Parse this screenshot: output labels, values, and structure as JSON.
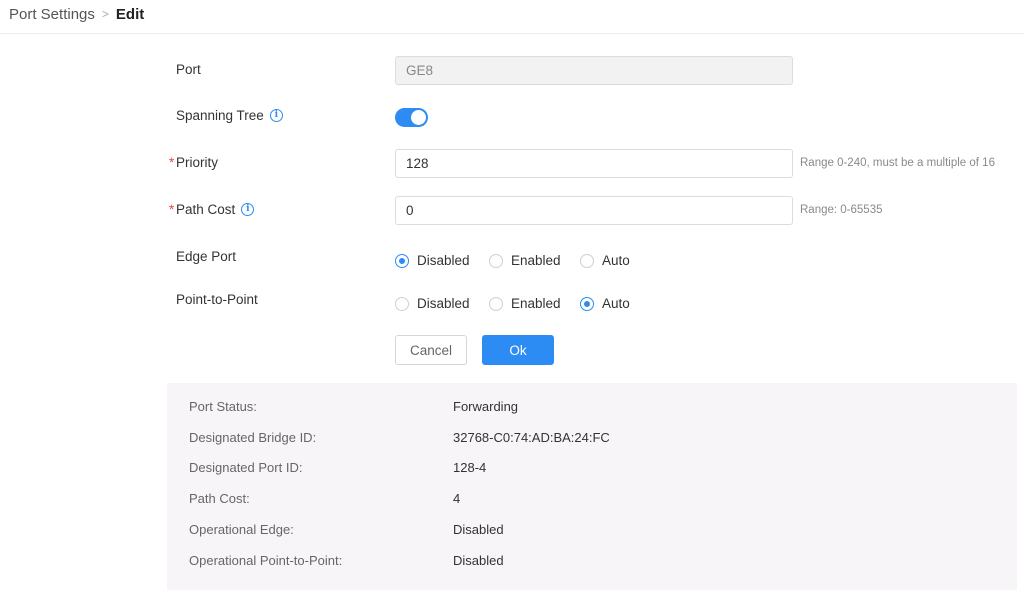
{
  "breadcrumb": {
    "parent": "Port Settings",
    "separator": ">",
    "current": "Edit"
  },
  "form": {
    "port": {
      "label": "Port",
      "value": "GE8"
    },
    "spanning_tree": {
      "label": "Spanning Tree",
      "info_icon": "i",
      "enabled": true
    },
    "priority": {
      "required_mark": "*",
      "label": "Priority",
      "value": "128",
      "hint": "Range 0-240, must be a multiple of 16"
    },
    "path_cost": {
      "required_mark": "*",
      "label": "Path Cost",
      "info_icon": "i",
      "value": "0",
      "hint": "Range: 0-65535"
    },
    "edge_port": {
      "label": "Edge Port",
      "options": [
        "Disabled",
        "Enabled",
        "Auto"
      ],
      "selected": "Disabled"
    },
    "point_to_point": {
      "label": "Point-to-Point",
      "options": [
        "Disabled",
        "Enabled",
        "Auto"
      ],
      "selected": "Auto"
    }
  },
  "buttons": {
    "cancel": "Cancel",
    "ok": "Ok"
  },
  "status": [
    {
      "label": "Port Status:",
      "value": "Forwarding"
    },
    {
      "label": "Designated Bridge ID:",
      "value": "32768-C0:74:AD:BA:24:FC"
    },
    {
      "label": "Designated Port ID:",
      "value": "128-4"
    },
    {
      "label": "Path Cost:",
      "value": "4"
    },
    {
      "label": "Operational Edge:",
      "value": "Disabled"
    },
    {
      "label": "Operational Point-to-Point:",
      "value": "Disabled"
    }
  ],
  "colors": {
    "accent": "#2c8cf4",
    "required": "#e64545",
    "panel_bg": "#f7f5f8"
  }
}
